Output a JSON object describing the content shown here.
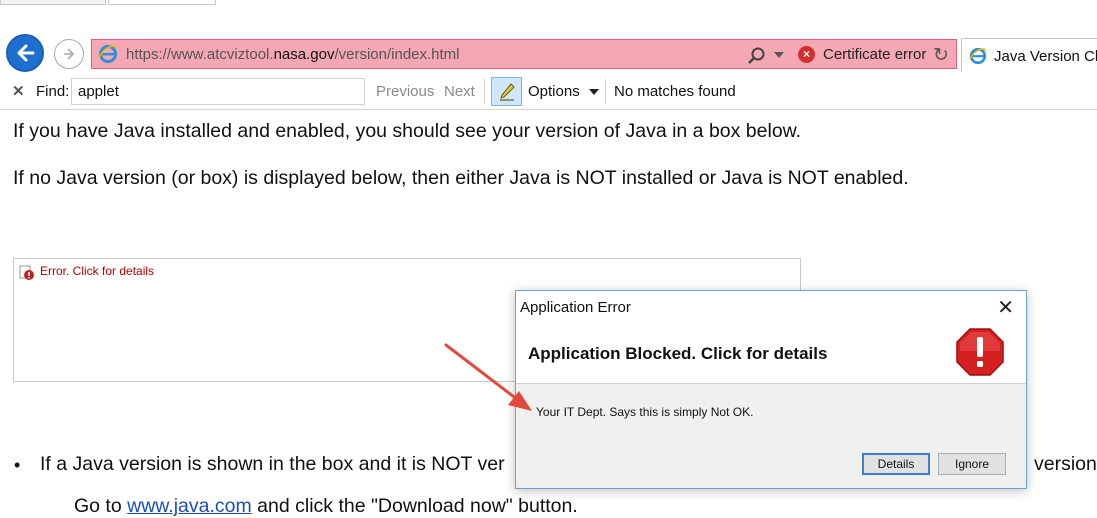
{
  "browser": {
    "address": {
      "url_prefix": "https://www.atcviztool.",
      "url_domain": "nasa.gov",
      "url_suffix": "/version/index.html",
      "certificate_text": "Certificate error"
    },
    "tab": {
      "label": "Java Version Che"
    }
  },
  "find_bar": {
    "label": "Find:",
    "query": "applet",
    "previous": "Previous",
    "next": "Next",
    "options": "Options",
    "status": "No matches found"
  },
  "page": {
    "para1": "If you have Java installed and enabled, you should see your version of Java in a box below.",
    "para2": "If no Java version (or box) is displayed below, then either Java is NOT installed or Java is NOT enabled.",
    "applet_error": "Error. Click for details",
    "bullet_dot": "•",
    "bullet_visible": "If a Java version is shown in the box and it is NOT ver",
    "bullet_tail": "version.",
    "sub_bullet_prefix": "Go to ",
    "sub_bullet_link": "www.java.com",
    "sub_bullet_suffix": " and click the \"Download now\" button."
  },
  "dialog": {
    "title": "Application Error",
    "heading": "Application Blocked. Click for details",
    "message": "Your IT Dept. Says this is simply Not OK.",
    "details_button": "Details",
    "ignore_button": "Ignore",
    "close_glyph": "✕"
  },
  "colors": {
    "address_bar_error": "#f5a8b4",
    "accent_blue": "#1f6fd1",
    "error_red": "#d32f2f",
    "annotation_arrow": "#e04a3c"
  }
}
